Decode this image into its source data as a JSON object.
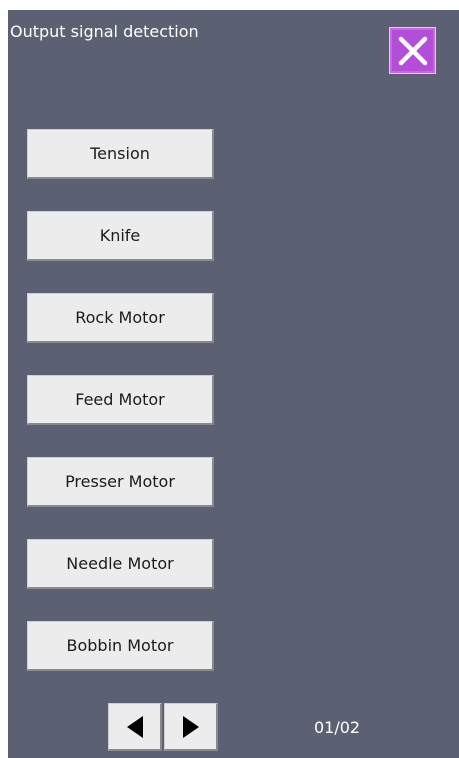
{
  "window": {
    "title": "Output signal detection",
    "close_icon": "close-x-icon",
    "accent_color": "#b44ed8",
    "background_color": "#5b6173"
  },
  "buttons": [
    {
      "label": "Tension"
    },
    {
      "label": "Knife"
    },
    {
      "label": "Rock Motor"
    },
    {
      "label": "Feed Motor"
    },
    {
      "label": "Presser Motor"
    },
    {
      "label": "Needle Motor"
    },
    {
      "label": "Bobbin Motor"
    }
  ],
  "pager": {
    "prev_icon": "triangle-left-icon",
    "next_icon": "triangle-right-icon",
    "page": "01/02"
  }
}
